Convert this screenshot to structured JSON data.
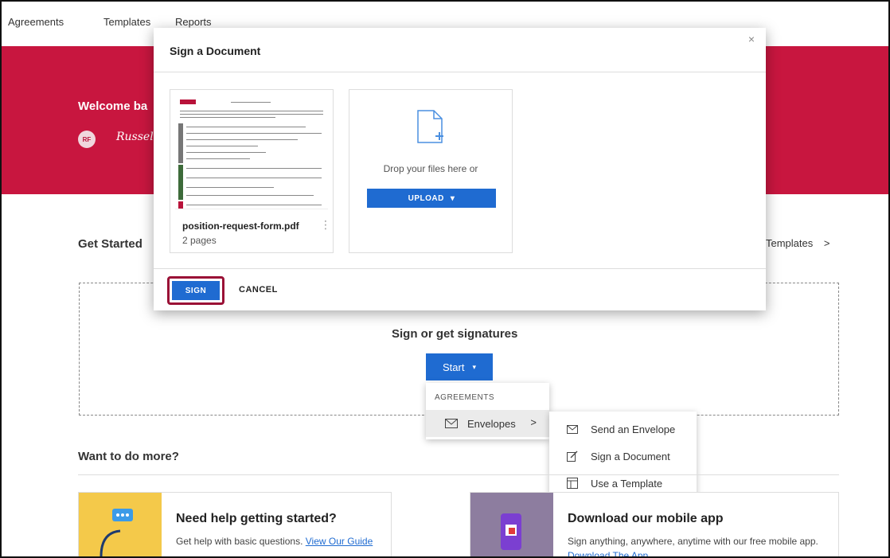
{
  "nav": {
    "items": [
      {
        "label": "Agreements"
      },
      {
        "label": "Templates"
      },
      {
        "label": "Reports"
      }
    ]
  },
  "hero": {
    "welcome": "Welcome ba",
    "avatar_initials": "RF",
    "signature": "Russell"
  },
  "get_started": {
    "heading": "Get Started",
    "templates_link": "Templates",
    "templates_chevron": ">"
  },
  "signature_box": {
    "heading": "Sign or get signatures",
    "start_label": "Start",
    "start_caret": "▾"
  },
  "start_menu": {
    "section": "AGREEMENTS",
    "envelopes_label": "Envelopes",
    "envelopes_chevron": ">"
  },
  "envelopes_submenu": {
    "items": [
      {
        "label": "Send an Envelope",
        "icon": "envelope-icon"
      },
      {
        "label": "Sign a Document",
        "icon": "sign-document-icon"
      },
      {
        "label": "Use a Template",
        "icon": "template-icon"
      }
    ]
  },
  "more": {
    "heading": "Want to do more?",
    "help_card": {
      "title": "Need help getting started?",
      "text": "Get help with basic questions. ",
      "link": "View Our Guide",
      "icon": "headset-chat-icon"
    },
    "mobile_card": {
      "title": "Download our mobile app",
      "text": "Sign anything, anywhere, anytime with our free mobile app. ",
      "link": "Download The App",
      "icon": "phone-app-icon"
    }
  },
  "modal": {
    "title": "Sign a Document",
    "close": "×",
    "file": {
      "name": "position-request-form.pdf",
      "pages": "2 pages",
      "menu": "⋮"
    },
    "drop": {
      "text": "Drop your files here or",
      "upload_label": "UPLOAD",
      "upload_caret": "▾"
    },
    "sign_label": "SIGN",
    "cancel_label": "CANCEL"
  },
  "colors": {
    "brand_red": "#c8163f",
    "primary_blue": "#1f6bd1",
    "highlight": "#9a1136"
  }
}
